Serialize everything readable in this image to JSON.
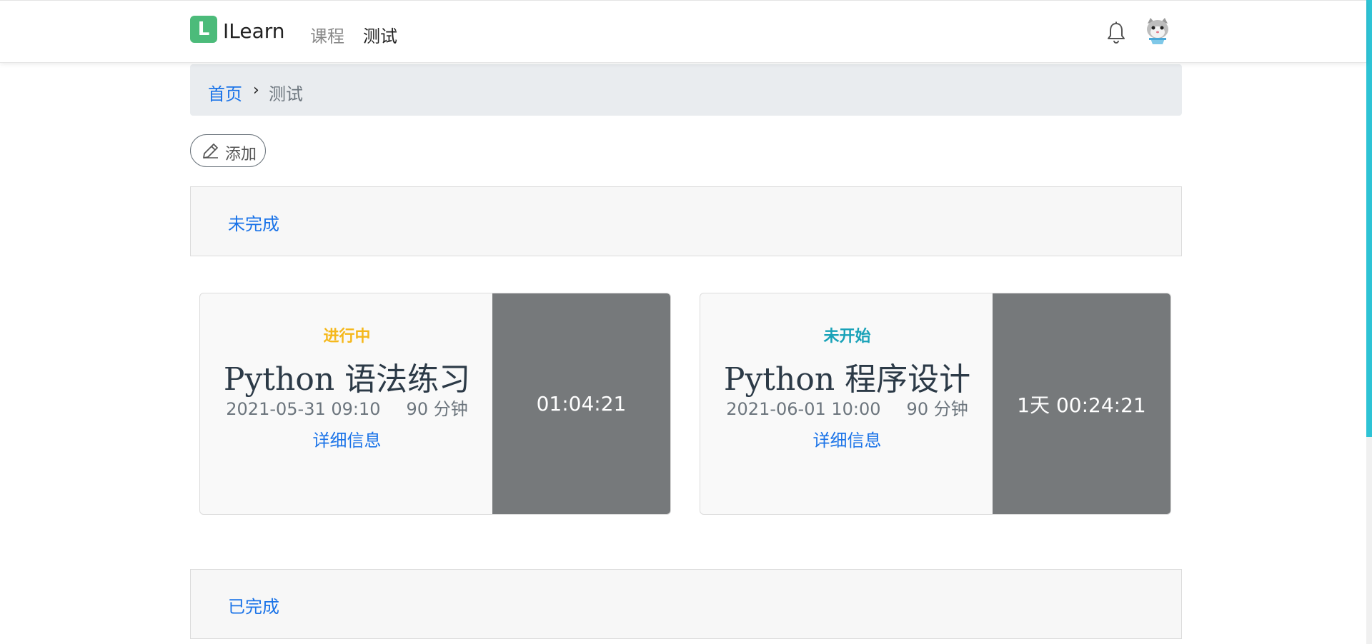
{
  "navbar": {
    "logo_letter": "L",
    "brand": "ILearn",
    "links": [
      "课程",
      "测试"
    ],
    "active_link": "测试"
  },
  "breadcrumb": {
    "home": "首页",
    "separator": "›",
    "current": "测试"
  },
  "toolbar": {
    "add_label": "添加"
  },
  "sections": {
    "incomplete": "未完成",
    "complete": "已完成"
  },
  "exams": [
    {
      "status": "进行中",
      "title": "Python 语法练习",
      "datetime": "2021-05-31 09:10",
      "duration": "90 分钟",
      "detail_link": "详细信息",
      "countdown": "01:04:21"
    },
    {
      "status": "未开始",
      "title": "Python 程序设计",
      "datetime": "2021-06-01 10:00",
      "duration": "90 分钟",
      "detail_link": "详细信息",
      "countdown": "1天 00:24:21"
    }
  ],
  "colors": {
    "accent": "#1a73e8",
    "logo": "#4cbb7a",
    "status_running": "#f5b81c",
    "status_pending": "#19a2b8",
    "timer_bg": "#76797b"
  },
  "icons": {
    "bell": "bell-icon",
    "avatar": "cat-avatar",
    "add": "pencil-icon"
  }
}
